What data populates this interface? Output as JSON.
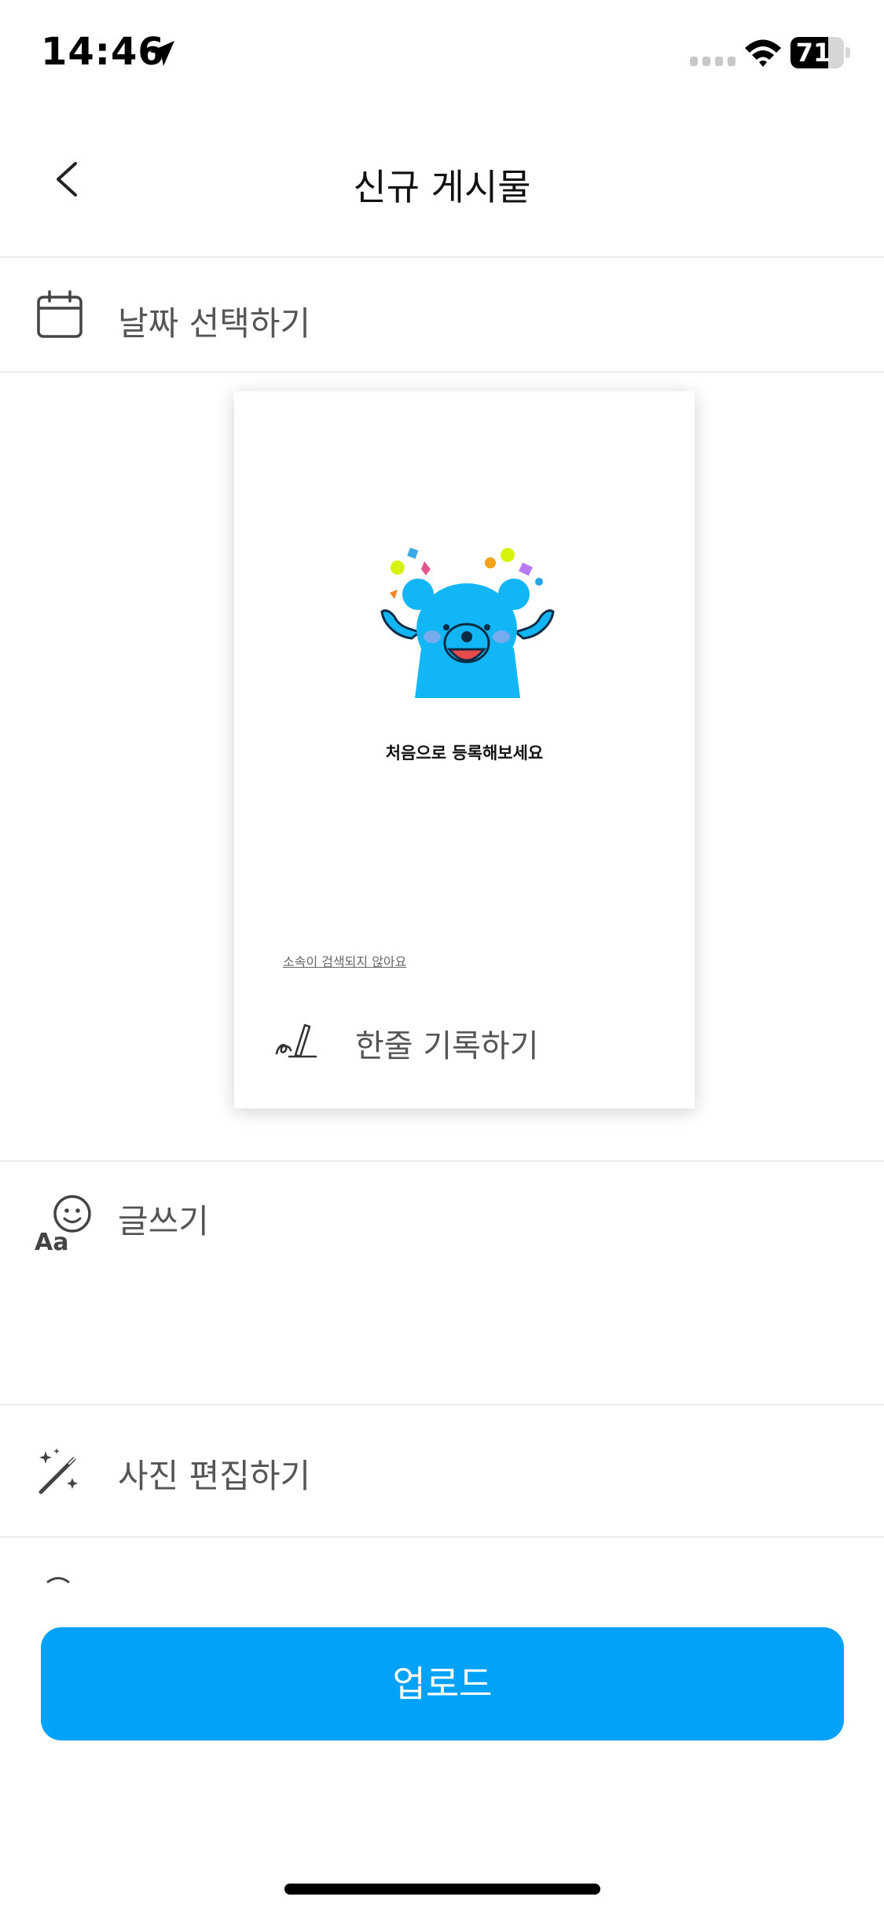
{
  "status_bar": {
    "time": "14:46",
    "battery": "71",
    "battery_level": 0.71,
    "location_icon": "location-arrow-icon",
    "wifi_icon": "wifi-icon"
  },
  "header": {
    "title": "신규 게시물",
    "back_icon": "chevron-left-icon"
  },
  "date_row": {
    "label": "날짜 선택하기",
    "icon": "calendar-icon"
  },
  "card": {
    "message": "처음으로 등록해보세요",
    "hint": "소속이 검색되지 않아요",
    "memo_label": "한줄 기록하기",
    "memo_icon": "pen-signature-icon",
    "illustration": "blue-bear-celebration"
  },
  "write_row": {
    "label": "글쓰기",
    "icon": "text-emoji-icon"
  },
  "edit_row": {
    "label": "사진 편집하기",
    "icon": "magic-wand-icon"
  },
  "upload": {
    "label": "업로드"
  },
  "colors": {
    "accent": "#03a2f9",
    "bear": "#12b6f5",
    "divider": "#ececec",
    "label": "#555555"
  }
}
